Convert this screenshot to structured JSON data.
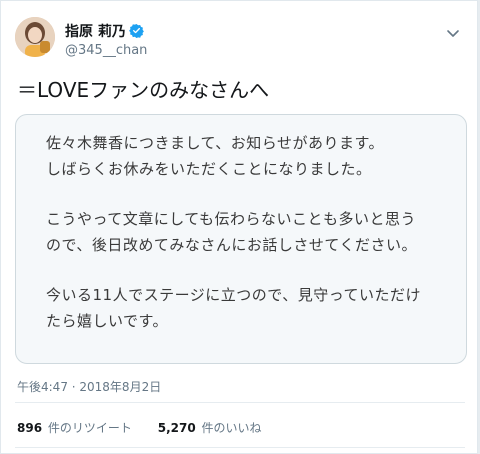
{
  "author": {
    "display_name": "指原 莉乃",
    "handle": "@345__chan"
  },
  "tweet": {
    "text": "＝LOVEファンのみなさんへ",
    "image_lines": [
      "佐々木舞香につきまして、お知らせがあります。",
      "しばらくお休みをいただくことになりました。",
      "こうやって文章にしても伝わらないことも多いと思う",
      "ので、後日改めてみなさんにお話しさせてください。",
      "今いる11人でステージに立つので、見守っていただけ",
      "たら嬉しいです。"
    ],
    "timestamp": "午後4:47 · 2018年8月2日"
  },
  "stats": {
    "retweets_count": "896",
    "retweets_label": "件のリツイート",
    "likes_count": "5,270",
    "likes_label": "件のいいね"
  },
  "colors": {
    "verified": "#1da1f2",
    "secondary_text": "#657786"
  }
}
